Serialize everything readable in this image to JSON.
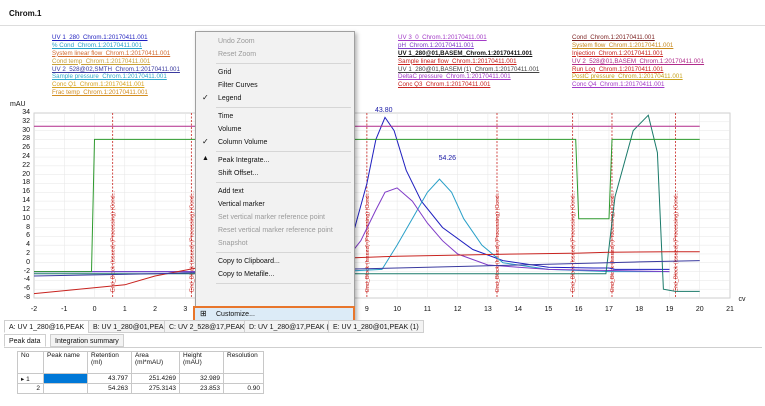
{
  "window": {
    "title": "Chrom.1"
  },
  "legend_columns": [
    {
      "items": [
        {
          "label": "UV 1_280_Chrom.1:20170411.001",
          "color": "#1f1fbf"
        },
        {
          "label": "% Cond_Chrom.1:20170411.001",
          "color": "#2aa0c8"
        },
        {
          "label": "System linear flow_Chrom.1:20170411.001",
          "color": "#d26a2e"
        },
        {
          "label": "Cond temp_Chrom.1:20170411.001",
          "color": "#c9a13a"
        },
        {
          "label": "UV 2_528@02,SMTH_Chrom.1:20170411.001",
          "color": "#3a3a9f"
        },
        {
          "label": "Sample pressure_Chrom.1:20170411.001",
          "color": "#33aacc"
        },
        {
          "label": "Conc Q1_Chrom.1:20170411.001",
          "color": "#d6a21f"
        },
        {
          "label": "Frac temp_Chrom.1:20170411.001",
          "color": "#d28c1e"
        }
      ]
    },
    {
      "items": [
        {
          "label": "UV 2_528_Chrom.1:20170411.001",
          "color": "#c8231f"
        },
        {
          "label": "Conc B_Chrom.1:20170411.001",
          "color": "#2e9a2e"
        },
        {
          "label": "System pressure_Chrom.1:20170411.001",
          "color": "#2aa89a"
        },
        {
          "label": "",
          "color": "#1f1fbf"
        },
        {
          "label": "",
          "color": "#2e9a2e"
        },
        {
          "label": "",
          "color": "#b24fb2"
        },
        {
          "label": "",
          "color": "#c8a31f"
        },
        {
          "label": "",
          "color": "#c8231f"
        }
      ]
    },
    {
      "items": [
        {
          "label": "UV 3_0_Chrom.1:20170411.001",
          "color": "#a33bc7"
        },
        {
          "label": "pH_Chrom.1:20170411.001",
          "color": "#7f3bc7"
        },
        {
          "label": "UV 1_280@01,BASEM_Chrom.1:20170411.001",
          "color": "#111111",
          "bold": true
        },
        {
          "label": "Sample linear flow_Chrom.1:20170411.001",
          "color": "#c8231f"
        },
        {
          "label": "UV 1_280@01,BASEM (1)_Chrom.1:20170411.001",
          "color": "#444444"
        },
        {
          "label": "DeltaC pressure_Chrom.1:20170411.001",
          "color": "#a33bc7"
        },
        {
          "label": "Conc Q3_Chrom.1:20170411.001",
          "color": "#c8231f"
        }
      ]
    },
    {
      "items": [
        {
          "label": "Cond_Chrom.1:20170411.001",
          "color": "#7a1f1f"
        },
        {
          "label": "System flow_Chrom.1:20170411.001",
          "color": "#c88a1f"
        },
        {
          "label": "Injection_Chrom.1:20170411.001",
          "color": "#c8231f"
        },
        {
          "label": "UV 2_528@01,BASEM_Chrom.1:20170411.001",
          "color": "#b02a8a"
        },
        {
          "label": "Run Log_Chrom.1:20170411.001",
          "color": "#c8231f"
        },
        {
          "label": "PostC pressure_Chrom.1:20170411.001",
          "color": "#c8a31f"
        },
        {
          "label": "Conc Q4_Chrom.1:20170411.001",
          "color": "#a33bc7"
        }
      ]
    }
  ],
  "chart_data": {
    "type": "line",
    "ylabel": "mAU",
    "xlabel": "cv",
    "xlim": [
      -2,
      21
    ],
    "ylim": [
      -8,
      34
    ],
    "x_ticks": [
      -2,
      -1,
      0,
      1,
      2,
      3,
      4,
      5,
      6,
      7,
      8,
      9,
      10,
      11,
      12,
      13,
      14,
      15,
      16,
      17,
      18,
      19,
      20,
      21
    ],
    "y_ticks": [
      -8,
      -6,
      -4,
      -2,
      0,
      2,
      4,
      6,
      8,
      10,
      12,
      14,
      16,
      18,
      20,
      22,
      24,
      26,
      28,
      30,
      32,
      34
    ],
    "grid": true,
    "peak_labels": [
      {
        "text": "43.80",
        "x": 9.6,
        "y": 34.5
      },
      {
        "text": "54.26",
        "x": 11.7,
        "y": 23.5
      }
    ],
    "series": [
      {
        "color": "#1f1fbf",
        "x": [
          -2,
          0,
          2,
          4,
          6,
          7,
          8,
          8.6,
          9.0,
          9.3,
          9.6,
          9.9,
          10.3,
          10.8,
          11.5,
          12.5,
          13.5,
          15,
          16.5,
          17,
          17.2,
          19
        ],
        "y": [
          -2,
          -2,
          -2,
          -2,
          -1.5,
          0,
          2,
          8,
          18,
          28,
          33,
          30,
          21,
          14,
          8,
          3,
          0.5,
          -1,
          -1.2,
          -1.2,
          -1.5,
          -1.5
        ]
      },
      {
        "color": "#2aa0c8",
        "x": [
          -2,
          4,
          8,
          9.5,
          10,
          10.5,
          11,
          11.4,
          11.8,
          12.2,
          12.8,
          13.5,
          15,
          17,
          19
        ],
        "y": [
          -2,
          -2,
          -2,
          -1.5,
          4,
          10,
          16,
          19,
          16,
          10,
          4,
          0,
          -1.5,
          -2,
          -2
        ]
      },
      {
        "color": "#7f3bc7",
        "x": [
          -2,
          8,
          8.8,
          9.3,
          9.6,
          10,
          10.5,
          11,
          11.5,
          12,
          13,
          15,
          19
        ],
        "y": [
          -2,
          -2,
          5,
          12,
          16,
          17,
          14,
          9,
          5,
          2,
          -0.5,
          -1.5,
          -2
        ]
      },
      {
        "color": "#1a7a6a",
        "x": [
          -2,
          2,
          8,
          12,
          16.9,
          17.2,
          17.8,
          18.3,
          18.6,
          18.8,
          19.2,
          20
        ],
        "y": [
          -2.5,
          -2.5,
          -2.5,
          -2.5,
          -2.5,
          15,
          30,
          33.5,
          25,
          -6,
          -6.5,
          -6.5
        ]
      },
      {
        "color": "#c8231f",
        "x": [
          -2,
          1,
          2,
          3.5,
          6,
          10,
          14,
          16,
          17,
          19,
          20
        ],
        "y": [
          -7,
          -5,
          -3,
          -1,
          0.5,
          1.5,
          2,
          2.2,
          2.4,
          2.5,
          2.5
        ]
      },
      {
        "color": "#2e9a2e",
        "x": [
          -2,
          -0.1,
          0,
          0.1,
          3,
          4,
          8,
          10,
          13,
          15.9,
          16,
          17,
          17.1,
          19,
          20
        ],
        "y": [
          -2,
          -2,
          28,
          28,
          28,
          28,
          28,
          28,
          28,
          28,
          10,
          10,
          28,
          28,
          28
        ]
      },
      {
        "color": "#b02a8a",
        "x": [
          -2,
          20
        ],
        "y": [
          31,
          31
        ]
      },
      {
        "color": "#3a3a9f",
        "x": [
          -2,
          2,
          6,
          10,
          14,
          18,
          20
        ],
        "y": [
          -3,
          -2.5,
          -1.8,
          -1.2,
          -0.5,
          0.2,
          0.5
        ]
      }
    ],
    "fraction_marker_text": "End_Block (Issued) (Processing) (Cond...",
    "fraction_markers_x": [
      0.6,
      3.2,
      4.3,
      9.0,
      13.3,
      15.8,
      17.1,
      19.2
    ]
  },
  "context_menu": {
    "items": [
      {
        "label": "Undo Zoom",
        "disabled": true
      },
      {
        "label": "Reset Zoom",
        "disabled": true
      },
      {
        "sep": true
      },
      {
        "label": "Grid"
      },
      {
        "label": "Filter Curves"
      },
      {
        "label": "Legend",
        "checked": true
      },
      {
        "sep": true
      },
      {
        "label": "Time"
      },
      {
        "label": "Volume"
      },
      {
        "label": "Column Volume",
        "checked": true
      },
      {
        "sep": true
      },
      {
        "label": "Peak Integrate...",
        "icon": "peak-icon"
      },
      {
        "label": "Shift Offset..."
      },
      {
        "sep": true
      },
      {
        "label": "Add text"
      },
      {
        "label": "Vertical marker"
      },
      {
        "label": "Set vertical marker reference point",
        "disabled": true
      },
      {
        "label": "Reset vertical marker reference point",
        "disabled": true
      },
      {
        "label": "Snapshot",
        "disabled": true
      },
      {
        "sep": true
      },
      {
        "label": "Copy to Clipboard..."
      },
      {
        "label": "Copy to Metafile..."
      },
      {
        "sep": true
      },
      {
        "label": "Customize...",
        "icon": "customize-icon",
        "highlighted": true
      }
    ]
  },
  "bottom_tabs": [
    {
      "label": "A: UV 1_280@16,PEAK",
      "active": true
    },
    {
      "label": "B: UV 1_280@01,PEAK"
    },
    {
      "label": "C: UV 2_528@17,PEAK"
    },
    {
      "label": "D: UV 1_280@17,PEAK (1)"
    },
    {
      "label": "E: UV 1_280@01,PEAK (1)"
    }
  ],
  "sub_tabs": [
    {
      "label": "Peak data",
      "active": true
    },
    {
      "label": "Integration summary"
    }
  ],
  "peak_table": {
    "headers": [
      "No",
      "Peak name",
      "Retention (ml)",
      "Area (ml*mAU)",
      "Height (mAU)",
      "Resolution"
    ],
    "rows": [
      {
        "no": "1",
        "name": "",
        "retention": "43.797",
        "area": "251.4269",
        "height": "32.989",
        "resolution": ""
      },
      {
        "no": "2",
        "name": "",
        "retention": "54.263",
        "area": "275.3143",
        "height": "23.853",
        "resolution": "0.90"
      }
    ]
  }
}
